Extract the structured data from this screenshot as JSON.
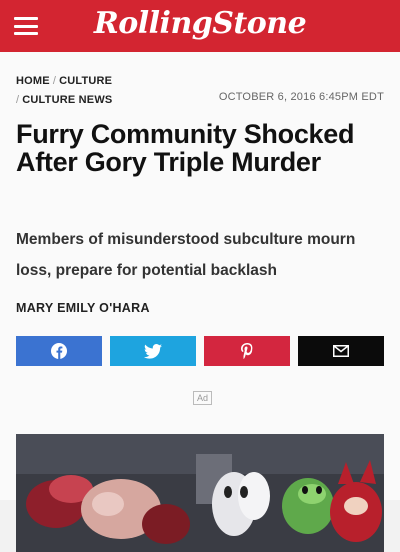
{
  "header": {
    "logo_text": "RollingStone",
    "brand_color": "#d32531"
  },
  "breadcrumb": {
    "items": [
      {
        "label": "HOME"
      },
      {
        "label": "CULTURE"
      },
      {
        "label": "CULTURE NEWS"
      }
    ],
    "separator": "/"
  },
  "article": {
    "date": "OCTOBER 6, 2016 6:45PM EDT",
    "headline": "Furry Community Shocked After Gory Triple Murder",
    "dek": "Members of misunderstood subculture mourn loss, prepare for potential backlash",
    "byline": "MARY EMILY O'HARA"
  },
  "share": {
    "buttons": [
      {
        "icon": "facebook-icon",
        "color": "#3b73d1"
      },
      {
        "icon": "twitter-icon",
        "color": "#1ea4df"
      },
      {
        "icon": "pinterest-icon",
        "color": "#d3263f"
      },
      {
        "icon": "email-icon",
        "color": "#0b0b0b"
      }
    ]
  },
  "ad": {
    "label": "Ad"
  }
}
